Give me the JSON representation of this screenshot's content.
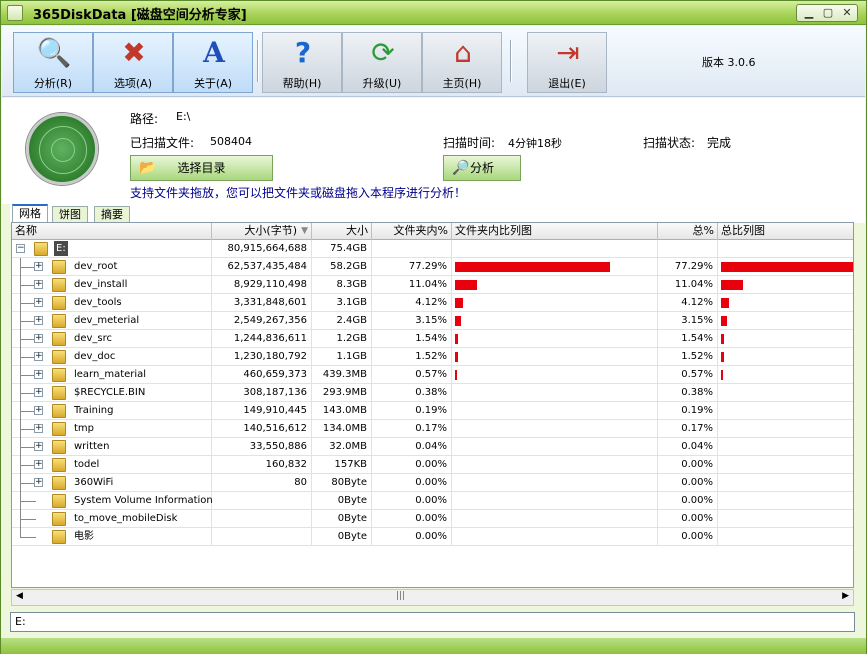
{
  "window": {
    "title": "365DiskData [磁盘空间分析专家]"
  },
  "toolbar": {
    "buttons": [
      {
        "label": "分析(R)",
        "icon": "analyze-icon"
      },
      {
        "label": "选项(A)",
        "icon": "options-icon"
      },
      {
        "label": "关于(A)",
        "icon": "about-icon"
      },
      {
        "label": "帮助(H)",
        "icon": "help-icon"
      },
      {
        "label": "升级(U)",
        "icon": "upgrade-icon"
      },
      {
        "label": "主页(H)",
        "icon": "home-icon"
      },
      {
        "label": "退出(E)",
        "icon": "exit-icon"
      }
    ],
    "version": "版本 3.0.6"
  },
  "info": {
    "path_label": "路径:",
    "path_value": "E:\\",
    "files_label": "已扫描文件:",
    "files_value": "508404",
    "time_label": "扫描时间:",
    "time_value": "4分钟18秒",
    "status_label": "扫描状态:",
    "status_value": "完成",
    "select_dir_label": "选择目录",
    "analyze_label": "分析",
    "hint": "支持文件夹拖放，您可以把文件夹或磁盘拖入本程序进行分析！"
  },
  "tabs": [
    "网格",
    "饼图",
    "摘要"
  ],
  "columns": [
    "名称",
    "大小(字节)",
    "大小",
    "文件夹内%",
    "文件夹内比列图",
    "总%",
    "总比列图"
  ],
  "root": {
    "name": "E:",
    "bytes": "80,915,664,688",
    "size": "75.4GB"
  },
  "rows": [
    {
      "name": "dev_root",
      "bytes": "62,537,435,484",
      "size": "58.2GB",
      "pct": "77.29%",
      "bar": 0.7729,
      "tpct": "77.29%",
      "tbar": 0.7729
    },
    {
      "name": "dev_install",
      "bytes": "8,929,110,498",
      "size": "8.3GB",
      "pct": "11.04%",
      "bar": 0.1104,
      "tpct": "11.04%",
      "tbar": 0.1104
    },
    {
      "name": "dev_tools",
      "bytes": "3,331,848,601",
      "size": "3.1GB",
      "pct": "4.12%",
      "bar": 0.0412,
      "tpct": "4.12%",
      "tbar": 0.0412
    },
    {
      "name": "dev_meterial",
      "bytes": "2,549,267,356",
      "size": "2.4GB",
      "pct": "3.15%",
      "bar": 0.0315,
      "tpct": "3.15%",
      "tbar": 0.0315
    },
    {
      "name": "dev_src",
      "bytes": "1,244,836,611",
      "size": "1.2GB",
      "pct": "1.54%",
      "bar": 0.0154,
      "tpct": "1.54%",
      "tbar": 0.0154
    },
    {
      "name": "dev_doc",
      "bytes": "1,230,180,792",
      "size": "1.1GB",
      "pct": "1.52%",
      "bar": 0.0152,
      "tpct": "1.52%",
      "tbar": 0.0152
    },
    {
      "name": "learn_material",
      "bytes": "460,659,373",
      "size": "439.3MB",
      "pct": "0.57%",
      "bar": 0.0057,
      "tpct": "0.57%",
      "tbar": 0.0057
    },
    {
      "name": "$RECYCLE.BIN",
      "bytes": "308,187,136",
      "size": "293.9MB",
      "pct": "0.38%",
      "bar": 0,
      "tpct": "0.38%",
      "tbar": 0
    },
    {
      "name": "Training",
      "bytes": "149,910,445",
      "size": "143.0MB",
      "pct": "0.19%",
      "bar": 0,
      "tpct": "0.19%",
      "tbar": 0
    },
    {
      "name": "tmp",
      "bytes": "140,516,612",
      "size": "134.0MB",
      "pct": "0.17%",
      "bar": 0,
      "tpct": "0.17%",
      "tbar": 0
    },
    {
      "name": "written",
      "bytes": "33,550,886",
      "size": "32.0MB",
      "pct": "0.04%",
      "bar": 0,
      "tpct": "0.04%",
      "tbar": 0
    },
    {
      "name": "todel",
      "bytes": "160,832",
      "size": "157KB",
      "pct": "0.00%",
      "bar": 0,
      "tpct": "0.00%",
      "tbar": 0
    },
    {
      "name": "360WiFi",
      "bytes": "80",
      "size": "80Byte",
      "pct": "0.00%",
      "bar": 0,
      "tpct": "0.00%",
      "tbar": 0
    },
    {
      "name": "System Volume Information",
      "bytes": "",
      "size": "0Byte",
      "pct": "0.00%",
      "bar": 0,
      "tpct": "0.00%",
      "tbar": 0
    },
    {
      "name": "to_move_mobileDisk",
      "bytes": "",
      "size": "0Byte",
      "pct": "0.00%",
      "bar": 0,
      "tpct": "0.00%",
      "tbar": 0
    },
    {
      "name": "电影",
      "bytes": "",
      "size": "0Byte",
      "pct": "0.00%",
      "bar": 0,
      "tpct": "0.00%",
      "tbar": 0
    }
  ],
  "statusbar": "E:",
  "colors": {
    "bar": "#e8000d",
    "titlebar": "#a9d35a"
  }
}
